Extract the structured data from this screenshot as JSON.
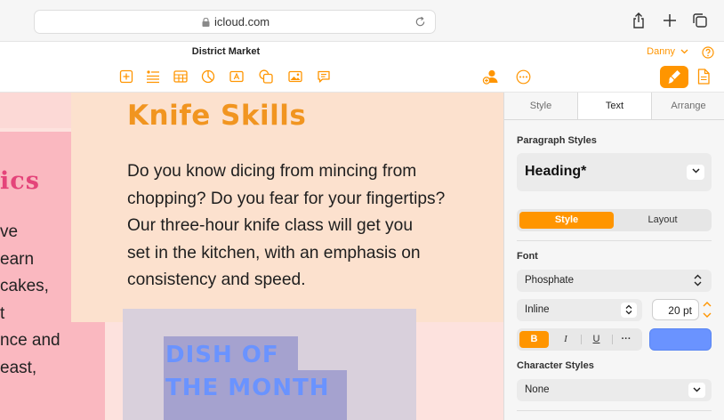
{
  "browser": {
    "url": "icloud.com",
    "icons": [
      "lock-icon",
      "reload-icon",
      "share-icon",
      "new-tab-icon",
      "tabs-overview-icon"
    ]
  },
  "toolbar": {
    "doc_title": "District Market",
    "user_name": "Danny",
    "insert_icons": [
      "add-page-icon",
      "text-list-icon",
      "table-icon",
      "chart-icon",
      "text-box-icon",
      "shape-icon",
      "media-icon",
      "comment-icon"
    ],
    "collab_icon": "collaborate-icon",
    "more_icon": "more-icon",
    "format_icon": "format-brush-icon",
    "document_icon": "document-icon",
    "accent": "#ff9500"
  },
  "canvas": {
    "left_heading_fragment": "ics",
    "left_text_fragments": [
      "ve",
      "earn",
      "cakes,",
      "t",
      "nce and",
      "east,"
    ],
    "main_heading": "Knife Skills",
    "main_lines": [
      "Do you know dicing from mincing from",
      "chopping? Do you fear for your fingertips?",
      "Our three-hour knife class will get you",
      "set in the kitchen, with an emphasis on",
      "consistency and speed."
    ],
    "dish_lines": [
      "DISH OF",
      "THE MONTH"
    ],
    "colors": {
      "background": "#fde2de",
      "heading": "#f19520",
      "left_heading": "#e4447a",
      "dish_text": "#6a93ff"
    }
  },
  "inspector": {
    "tabs": [
      {
        "label": "Style",
        "active": false
      },
      {
        "label": "Text",
        "active": true
      },
      {
        "label": "Arrange",
        "active": false
      }
    ],
    "paragraph_styles_label": "Paragraph Styles",
    "paragraph_style_value": "Heading*",
    "segment": {
      "active": "Style",
      "inactive": "Layout"
    },
    "font_label": "Font",
    "font_family": "Phosphate",
    "font_typeface": "Inline",
    "font_size": "20 pt",
    "format_buttons": {
      "bold": "B",
      "italic": "I",
      "underline": "U",
      "more": "···"
    },
    "text_color": "#6a93ff",
    "character_styles_label": "Character Styles",
    "character_style_value": "None"
  }
}
